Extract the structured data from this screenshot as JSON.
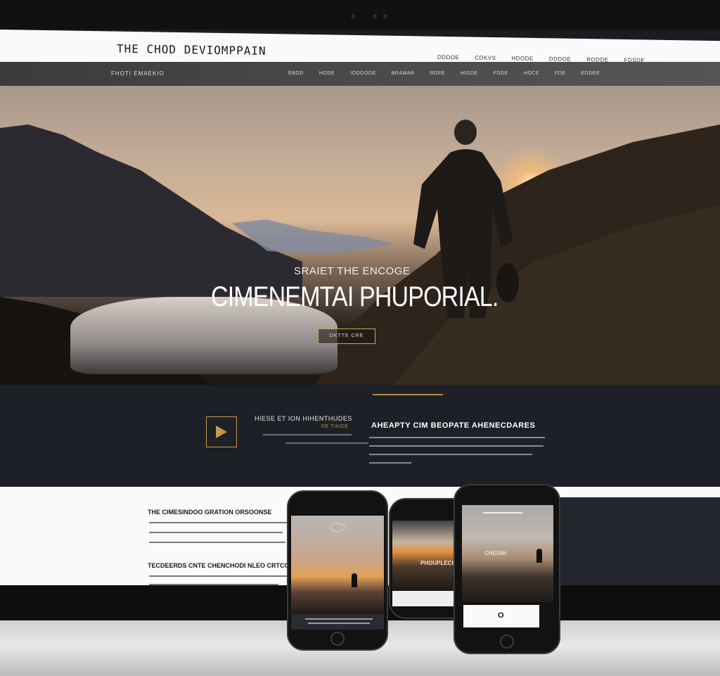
{
  "site": {
    "title": "THE CHOD DEVIOMPPAIN",
    "top_links": [
      "DDDOE",
      "CDKVS",
      "HDODE",
      "DDDOE",
      "RODDE",
      "FDSDE"
    ]
  },
  "navbar": {
    "brand": "FHOTI EMAEKIO",
    "links": [
      "EBOD",
      "HODE",
      "IODGODE",
      "BRAMAR",
      "RDEE",
      "HIGDE",
      "FDDE",
      "HOCE",
      "FDE",
      "EDDEE"
    ]
  },
  "hero": {
    "caption": "SRAIET THE ENCOGE",
    "title": "CIMENEMTAI PHUPORIAL.",
    "button_label": "DKTTE CRE"
  },
  "feature": {
    "left_title": "HIESE ET ION HIHENTHUDES",
    "left_subtitle": "DE TIAIDE",
    "right_title": "AHEAPTY CIM BEOPATE AHENECDARES"
  },
  "lower": {
    "heading_1": "THE CIMESINDOO GRATION ORSOONSE",
    "heading_2": "TECDEERDS CNTE CHENCHODI NLEO CRTCOD"
  },
  "phones": {
    "center_caption": "PHOUPLECHE",
    "right_caption": "CHEOIH",
    "right_button_mark": "O"
  },
  "colors": {
    "accent_gold": "#c29a4a",
    "dark_panel": "#1e2027",
    "navbar": "#4a4a4a"
  }
}
